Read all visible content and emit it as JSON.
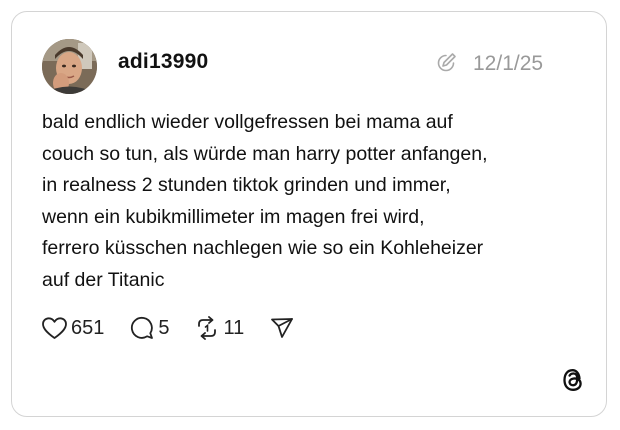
{
  "post": {
    "username": "adi13990",
    "date": "12/1/25",
    "text": "bald endlich wieder vollgefressen bei mama auf\ncouch so tun, als würde man harry potter anfangen,\nin realness 2 stunden tiktok grinden und immer,\nwenn ein kubikmillimeter im magen frei wird,\nferrero küsschen nachlegen wie so ein Kohleheizer\nauf der Titanic"
  },
  "actions": {
    "likes": "651",
    "replies": "5",
    "reposts": "11"
  },
  "icons": {
    "edited": "edited-pencil-icon",
    "like": "heart-icon",
    "reply": "speech-bubble-icon",
    "repost": "repost-arrows-icon",
    "share": "paper-plane-icon",
    "brand": "threads-logo-icon"
  },
  "colors": {
    "text": "#111111",
    "muted": "#999999",
    "border": "#d4d4d4"
  }
}
